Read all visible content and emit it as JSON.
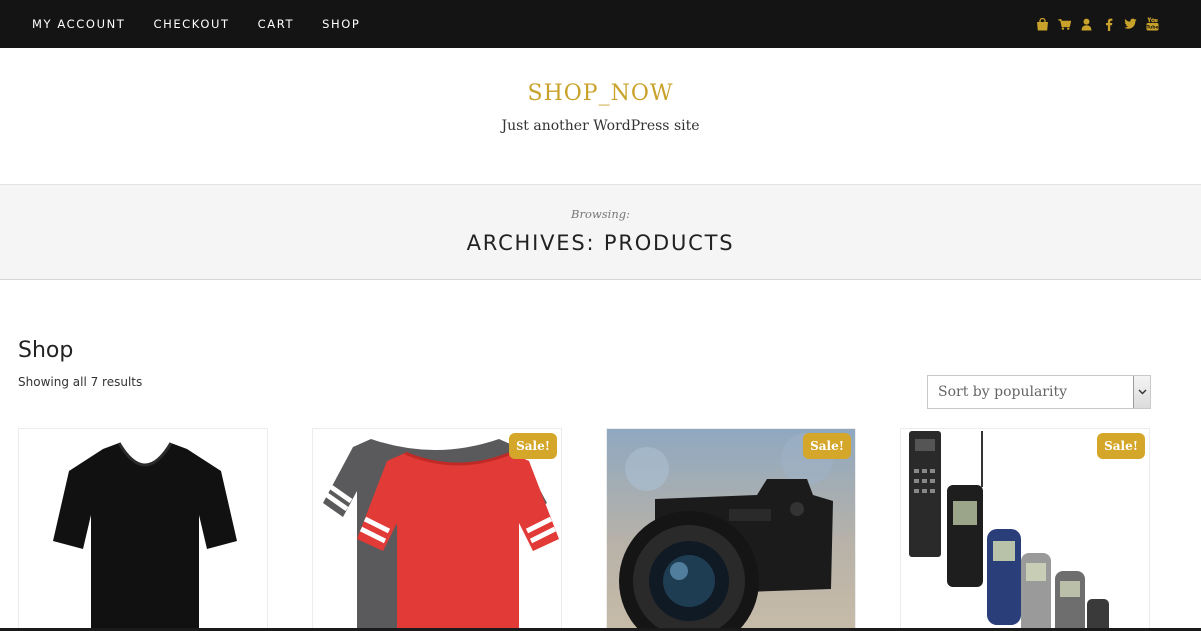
{
  "nav": {
    "items": [
      {
        "label": "MY ACCOUNT"
      },
      {
        "label": "CHECKOUT"
      },
      {
        "label": "CART"
      },
      {
        "label": "SHOP"
      }
    ]
  },
  "social_icons": [
    "shopping-bag-icon",
    "cart-icon",
    "user-icon",
    "facebook-icon",
    "twitter-icon",
    "youtube-icon"
  ],
  "colors": {
    "accent": "#c9a22b",
    "topbar": "#141414",
    "sale_badge": "#d4a62a",
    "archive_bg": "#f5f5f5"
  },
  "site": {
    "title": "SHOP_NOW",
    "description": "Just another WordPress site"
  },
  "archive": {
    "browsing": "Browsing:",
    "title": "ARCHIVES: PRODUCTS"
  },
  "shop": {
    "heading": "Shop",
    "result_count": "Showing all 7 results",
    "sort": {
      "selected": "Sort by popularity"
    }
  },
  "products": [
    {
      "image": "black-tshirt",
      "on_sale": false
    },
    {
      "image": "red-grey-tshirts",
      "on_sale": true,
      "badge": "Sale!"
    },
    {
      "image": "camera",
      "on_sale": true,
      "badge": "Sale!"
    },
    {
      "image": "mobile-phones",
      "on_sale": true,
      "badge": "Sale!"
    }
  ]
}
